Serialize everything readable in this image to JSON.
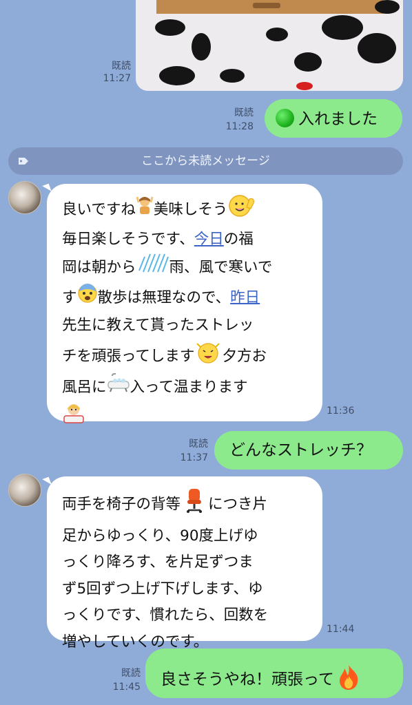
{
  "messages": {
    "m1": {
      "read": "既読",
      "time": "11:27"
    },
    "m2": {
      "read": "既読",
      "time": "11:28",
      "text": "入れました",
      "icon": "green-circle-icon"
    },
    "divider": {
      "label": "ここから未読メッセージ"
    },
    "m3": {
      "time": "11:36",
      "l1a": "良いですね",
      "l1b": "美味しそう",
      "l2a": "毎日楽しそうです、",
      "l2link": "今日",
      "l2b": "の福",
      "l3a": "岡は朝から",
      "l3b": "雨、風で寒いで",
      "l4a": "す",
      "l4b": "散歩は無理なので、",
      "l4link": "昨日",
      "l5": "先生に教えて貰ったストレッ",
      "l6a": "チを頑張ってします",
      "l6b": "夕方お",
      "l7a": "風呂に",
      "l7b": "入って温まります"
    },
    "m4": {
      "read": "既読",
      "time": "11:37",
      "text": "どんなストレッチ？"
    },
    "m5": {
      "time": "11:44",
      "l1a": "両手を椅子の背等",
      "l1b": "につき片",
      "l2": "足からゆっくり、90度上げゆ",
      "l3": "っくり降ろす、を片足ずつま",
      "l4": "ず5回ずつ上げ下げします、ゆ",
      "l5": "っくりです、慣れたら、回数を",
      "l6": "増やしていくのです。"
    },
    "m6": {
      "read": "既読",
      "time": "11:45",
      "text": "良さそうやね！頑張って",
      "icon": "fire-icon"
    }
  },
  "colors": {
    "chat_bg": "#8facd9",
    "outgoing_bubble": "#8cea8c",
    "incoming_bubble": "#ffffff",
    "link": "#3b63c8"
  }
}
